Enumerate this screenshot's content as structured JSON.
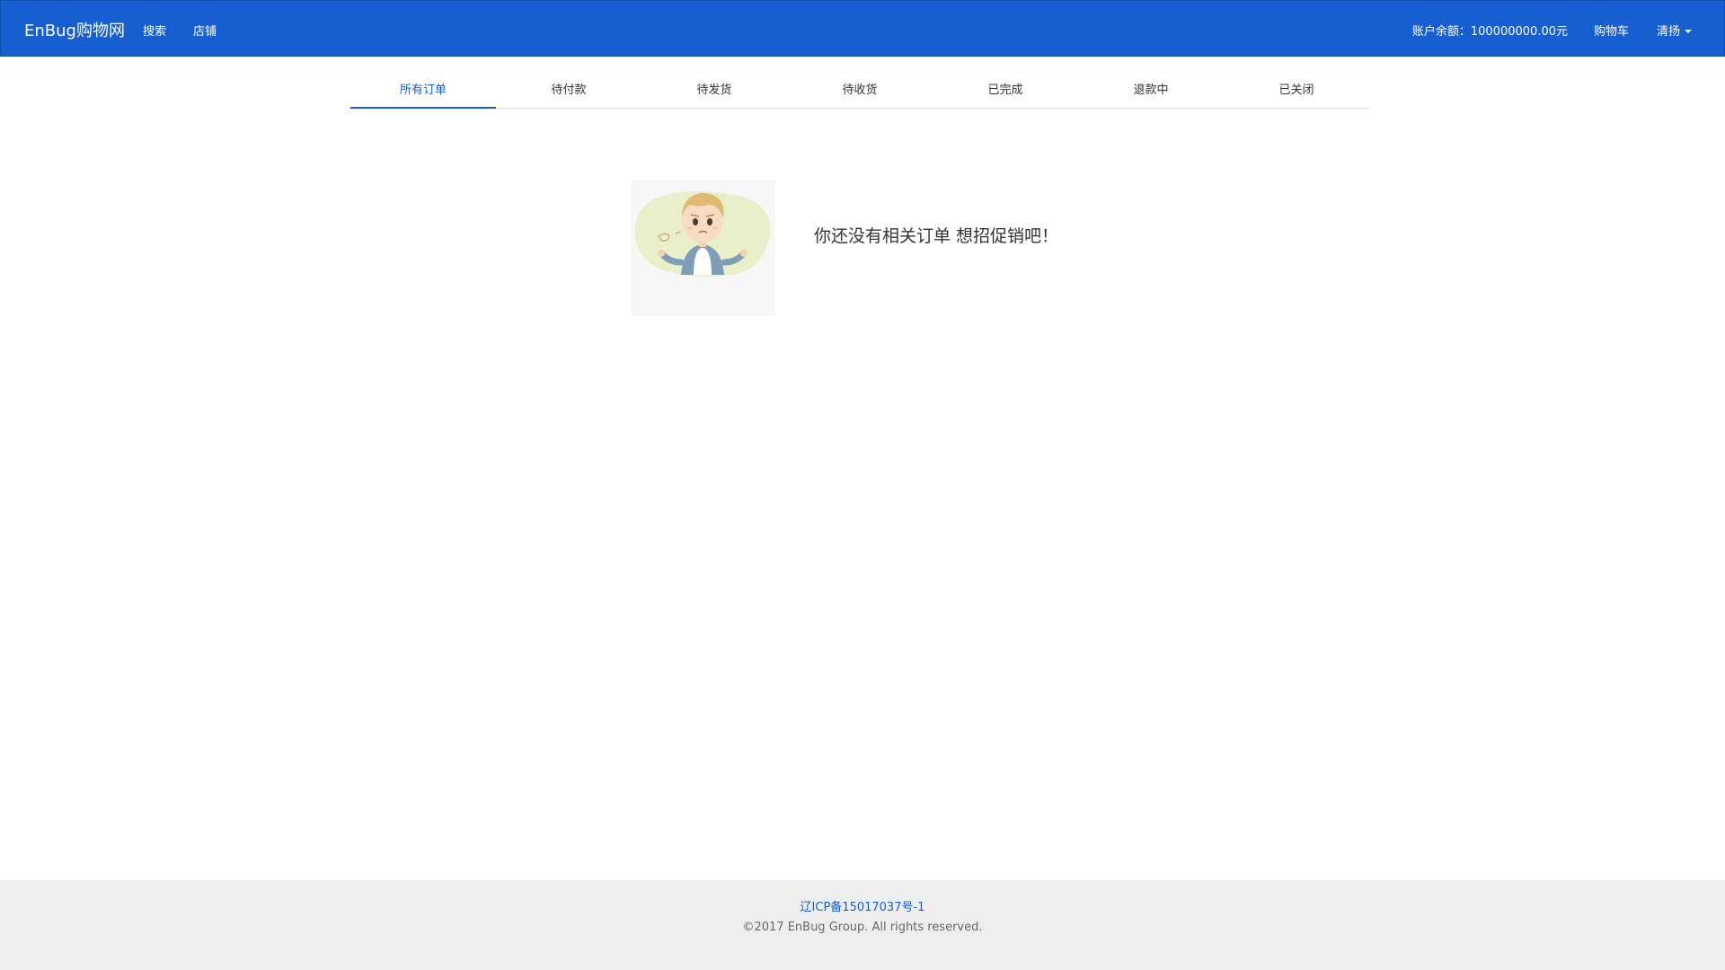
{
  "navbar": {
    "brand": "EnBug购物网",
    "links": {
      "search": "搜索",
      "shops": "店铺"
    },
    "balance": "账户余额：100000000.00元",
    "cart": "购物车",
    "user": "清扬"
  },
  "tabs": [
    {
      "label": "所有订单",
      "active": true
    },
    {
      "label": "待付款",
      "active": false
    },
    {
      "label": "待发货",
      "active": false
    },
    {
      "label": "待收货",
      "active": false
    },
    {
      "label": "已完成",
      "active": false
    },
    {
      "label": "退款中",
      "active": false
    },
    {
      "label": "已关闭",
      "active": false
    }
  ],
  "empty_state": {
    "message": "你还没有相关订单 想招促销吧！"
  },
  "footer": {
    "icp": "辽ICP备15017037号-1",
    "copyright": "©2017 EnBug Group. All rights reserved."
  },
  "colors": {
    "navbar": "#175ed1",
    "accent": "#175ed1",
    "footer_bg": "#eeeeee"
  }
}
